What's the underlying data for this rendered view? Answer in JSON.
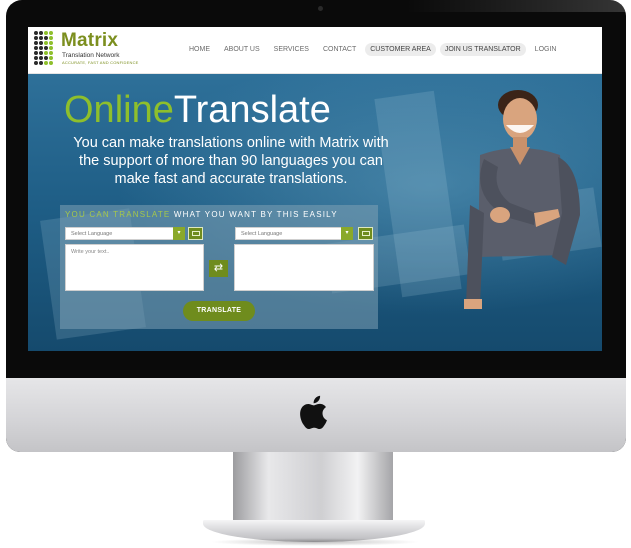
{
  "brand": {
    "name": "Matrix",
    "subtitle": "Translation Network",
    "tagline": "ACCURATE, FAST AND CONFIDENCE",
    "accent": "#7c8f1f"
  },
  "nav": {
    "items": [
      {
        "label": "HOME"
      },
      {
        "label": "ABOUT US"
      },
      {
        "label": "SERVICES"
      },
      {
        "label": "CONTACT"
      },
      {
        "label": "CUSTOMER AREA"
      },
      {
        "label": "JOIN US TRANSLATOR"
      },
      {
        "label": "LOGIN"
      }
    ]
  },
  "hero": {
    "title_part1": "Online",
    "title_part2": "Translate",
    "text": "You can make translations online with Matrix with the support of more than 90 languages you can make fast and accurate translations."
  },
  "translator": {
    "heading_part1": "YOU CAN TRANSLATE",
    "heading_part2": " WHAT YOU WANT BY THIS EASILY",
    "source_language": {
      "placeholder": "Select Language"
    },
    "target_language": {
      "placeholder": "Select Language"
    },
    "source_text": {
      "placeholder": "Write your text.."
    },
    "swap_icon": "swap-arrows-icon",
    "keyboard_icon": "keyboard-icon",
    "button_label": "TRANSLATE"
  },
  "colors": {
    "primary_green": "#6f8c1d",
    "hero_blue": "#1f5f86"
  }
}
